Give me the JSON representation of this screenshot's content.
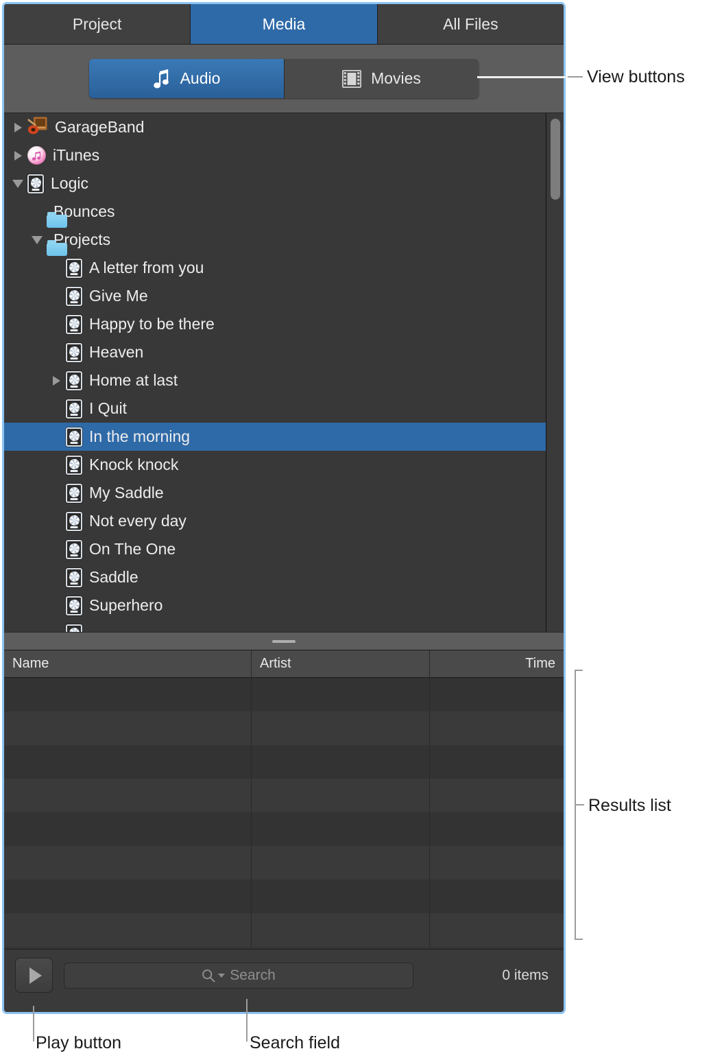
{
  "tabs": [
    {
      "label": "Project",
      "active": false
    },
    {
      "label": "Media",
      "active": true
    },
    {
      "label": "All Files",
      "active": false
    }
  ],
  "view_buttons": [
    {
      "label": "Audio",
      "icon": "music-note-icon",
      "active": true
    },
    {
      "label": "Movies",
      "icon": "film-strip-icon",
      "active": false
    }
  ],
  "tree": [
    {
      "label": "GarageBand",
      "icon": "garageband-icon",
      "depth": 0,
      "disclosure": "closed",
      "selected": false
    },
    {
      "label": "iTunes",
      "icon": "itunes-icon",
      "depth": 0,
      "disclosure": "closed",
      "selected": false
    },
    {
      "label": "Logic",
      "icon": "logic-project-icon",
      "depth": 0,
      "disclosure": "open",
      "selected": false
    },
    {
      "label": "Bounces",
      "icon": "folder-icon",
      "depth": 1,
      "disclosure": "none",
      "selected": false
    },
    {
      "label": "Projects",
      "icon": "folder-icon",
      "depth": 1,
      "disclosure": "open",
      "selected": false
    },
    {
      "label": "A letter from you",
      "icon": "logic-project-icon",
      "depth": 2,
      "disclosure": "none",
      "selected": false
    },
    {
      "label": "Give Me",
      "icon": "logic-project-icon",
      "depth": 2,
      "disclosure": "none",
      "selected": false
    },
    {
      "label": "Happy to be there",
      "icon": "logic-project-icon",
      "depth": 2,
      "disclosure": "none",
      "selected": false
    },
    {
      "label": "Heaven",
      "icon": "logic-project-icon",
      "depth": 2,
      "disclosure": "none",
      "selected": false
    },
    {
      "label": "Home at last",
      "icon": "logic-project-icon",
      "depth": 2,
      "disclosure": "closed",
      "selected": false
    },
    {
      "label": "I Quit",
      "icon": "logic-project-icon",
      "depth": 2,
      "disclosure": "none",
      "selected": false
    },
    {
      "label": "In the morning",
      "icon": "logic-project-icon",
      "depth": 2,
      "disclosure": "none",
      "selected": true
    },
    {
      "label": "Knock knock",
      "icon": "logic-project-icon",
      "depth": 2,
      "disclosure": "none",
      "selected": false
    },
    {
      "label": "My Saddle",
      "icon": "logic-project-icon",
      "depth": 2,
      "disclosure": "none",
      "selected": false
    },
    {
      "label": "Not every day",
      "icon": "logic-project-icon",
      "depth": 2,
      "disclosure": "none",
      "selected": false
    },
    {
      "label": "On The One",
      "icon": "logic-project-icon",
      "depth": 2,
      "disclosure": "none",
      "selected": false
    },
    {
      "label": "Saddle",
      "icon": "logic-project-icon",
      "depth": 2,
      "disclosure": "none",
      "selected": false
    },
    {
      "label": "Superhero",
      "icon": "logic-project-icon",
      "depth": 2,
      "disclosure": "none",
      "selected": false
    },
    {
      "label": "",
      "icon": "logic-project-icon",
      "depth": 2,
      "disclosure": "none",
      "selected": false
    }
  ],
  "results_list": {
    "columns": [
      {
        "label": "Name",
        "align": "left"
      },
      {
        "label": "Artist",
        "align": "left"
      },
      {
        "label": "Time",
        "align": "right"
      }
    ],
    "rows": [],
    "empty_row_count": 8
  },
  "bottom_bar": {
    "play_icon": "play-icon",
    "search": {
      "icon": "search-magnifier-icon",
      "dropdown_icon": "chevron-down-icon",
      "placeholder": "Search",
      "value": ""
    },
    "item_count": "0 items"
  },
  "annotations": [
    {
      "key": "view_buttons",
      "text": "View buttons"
    },
    {
      "key": "results_list",
      "text": "Results list"
    },
    {
      "key": "play_button",
      "text": "Play button"
    },
    {
      "key": "search_field",
      "text": "Search field"
    }
  ],
  "annotation_labels": {
    "view_buttons": "View buttons",
    "results_list": "Results list",
    "play_button": "Play button",
    "search_field": "Search field"
  },
  "colors": {
    "accent_blue": "#2f6aa8",
    "focus_ring": "#8cc3f2",
    "panel_bg": "#383838",
    "toolbar_bg": "#5d5d5d",
    "folder_blue": "#8fd4f3"
  }
}
